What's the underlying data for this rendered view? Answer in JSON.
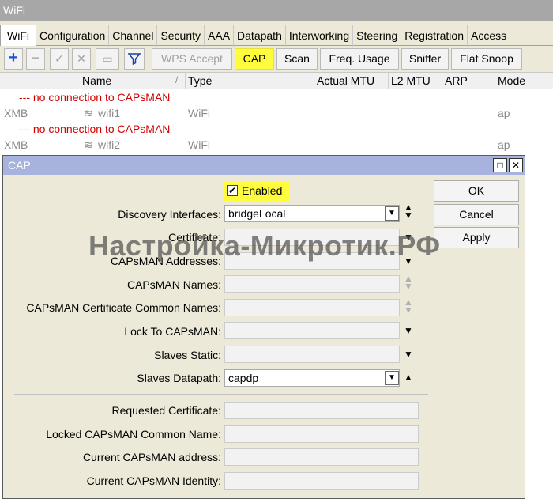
{
  "window": {
    "title": "WiFi"
  },
  "tabs": [
    "WiFi",
    "Configuration",
    "Channel",
    "Security",
    "AAA",
    "Datapath",
    "Interworking",
    "Steering",
    "Registration",
    "Access"
  ],
  "toolbar": {
    "add_icon": "plus-icon",
    "wps": "WPS Accept",
    "cap": "CAP",
    "scan": "Scan",
    "freq": "Freq. Usage",
    "sniffer": "Sniffer",
    "flat_snoop": "Flat Snoop",
    "highlight_color": "#fffb3d"
  },
  "grid": {
    "columns": [
      "Name",
      "Type",
      "Actual MTU",
      "L2 MTU",
      "ARP",
      "Mode"
    ],
    "rows": [
      {
        "comment": "--- no connection to CAPsMAN"
      },
      {
        "flag": "XMB",
        "name": "wifi1",
        "type": "WiFi",
        "mode": "ap"
      },
      {
        "comment": "--- no connection to CAPsMAN"
      },
      {
        "flag": "XMB",
        "name": "wifi2",
        "type": "WiFi",
        "mode": "ap"
      }
    ]
  },
  "dialog": {
    "title": "CAP",
    "enabled_label": "Enabled",
    "enabled_checked": true,
    "buttons": {
      "ok": "OK",
      "cancel": "Cancel",
      "apply": "Apply"
    },
    "fields": {
      "discovery_interfaces": {
        "label": "Discovery Interfaces:",
        "value": "bridgeLocal"
      },
      "certificate": {
        "label": "Certificate:",
        "value": ""
      },
      "capsman_addresses": {
        "label": "CAPsMAN Addresses:",
        "value": ""
      },
      "capsman_names": {
        "label": "CAPsMAN Names:",
        "value": ""
      },
      "capsman_cert_common_names": {
        "label": "CAPsMAN Certificate Common Names:",
        "value": ""
      },
      "lock_to_capsman": {
        "label": "Lock To CAPsMAN:",
        "value": ""
      },
      "slaves_static": {
        "label": "Slaves Static:",
        "value": ""
      },
      "slaves_datapath": {
        "label": "Slaves Datapath:",
        "value": "capdp"
      },
      "requested_certificate": {
        "label": "Requested Certificate:",
        "value": ""
      },
      "locked_capsman_common_name": {
        "label": "Locked CAPsMAN Common Name:",
        "value": ""
      },
      "current_capsman_address": {
        "label": "Current CAPsMAN address:",
        "value": ""
      },
      "current_capsman_identity": {
        "label": "Current CAPsMAN Identity:",
        "value": ""
      }
    }
  },
  "watermark": "Настройка-Микротик.РФ"
}
